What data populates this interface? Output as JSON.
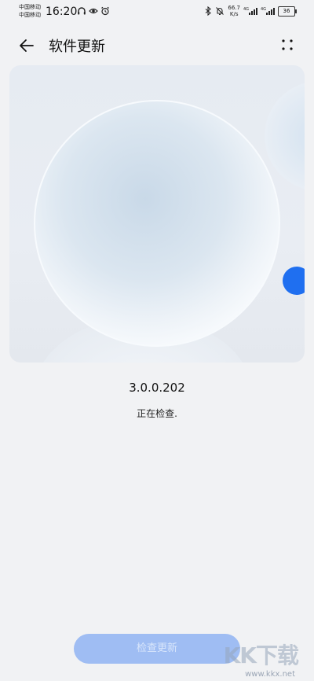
{
  "status_bar": {
    "carrier_1": "中国移动",
    "carrier_2": "中国移动",
    "time": "16:20",
    "net_speed_value": "66.7",
    "net_speed_unit": "K/s",
    "signal_1_label": "4G",
    "signal_2_label": "4G",
    "battery": "36"
  },
  "header": {
    "title": "软件更新"
  },
  "main": {
    "version": "3.0.0.202",
    "status": "正在检查."
  },
  "button": {
    "label": "检查更新"
  },
  "watermark": {
    "logo": "KK下载",
    "url": "www.kkx.net"
  },
  "colors": {
    "background": "#f1f2f4",
    "accent_dot": "#1f6ff0",
    "button_bg": "#9fbdf3"
  }
}
